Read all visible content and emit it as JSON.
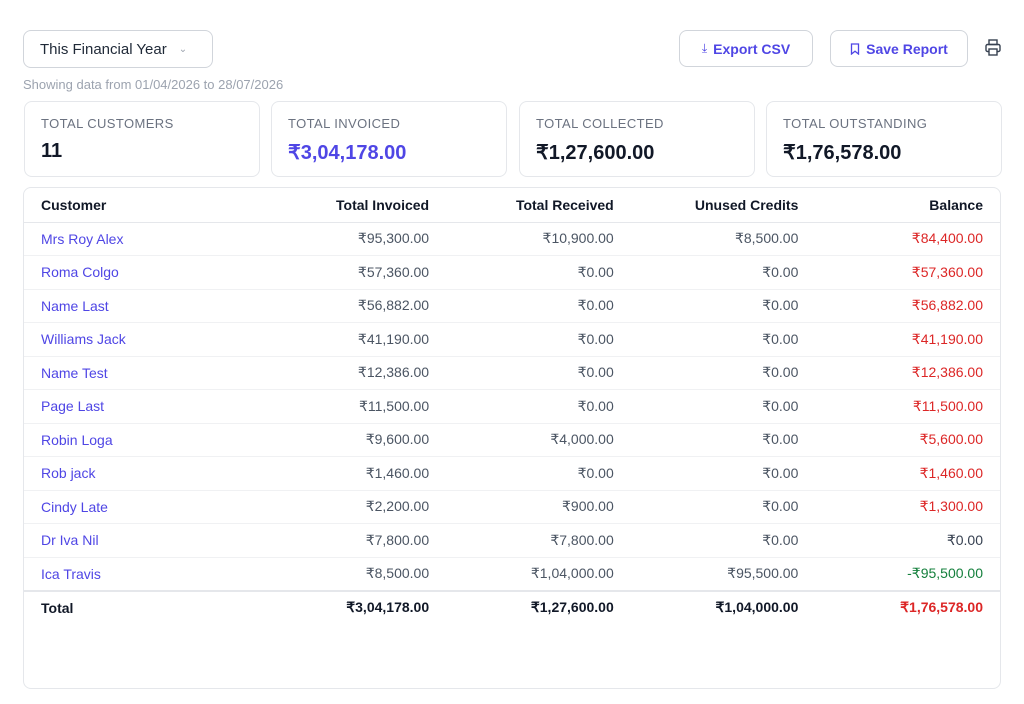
{
  "filter": {
    "period": "This Financial Year"
  },
  "actions": {
    "export_label": "Export CSV",
    "save_label": "Save Report"
  },
  "range_note": "Showing data from 01/04/2026 to 28/07/2026",
  "cards": [
    {
      "title": "TOTAL CUSTOMERS",
      "value": "11"
    },
    {
      "title": "TOTAL INVOICED",
      "value": "₹3,04,178.00"
    },
    {
      "title": "TOTAL COLLECTED",
      "value": "₹1,27,600.00"
    },
    {
      "title": "TOTAL OUTSTANDING",
      "value": "₹1,76,578.00"
    }
  ],
  "table": {
    "headers": [
      "Customer",
      "Total Invoiced",
      "Total Received",
      "Unused Credits",
      "Balance"
    ],
    "rows": [
      {
        "customer": "Mrs Roy Alex",
        "invoiced": "₹95,300.00",
        "received": "₹10,900.00",
        "credits": "₹8,500.00",
        "balance": "₹84,400.00",
        "status": "pos"
      },
      {
        "customer": "Roma Colgo",
        "invoiced": "₹57,360.00",
        "received": "₹0.00",
        "credits": "₹0.00",
        "balance": "₹57,360.00",
        "status": "pos"
      },
      {
        "customer": "Name Last",
        "invoiced": "₹56,882.00",
        "received": "₹0.00",
        "credits": "₹0.00",
        "balance": "₹56,882.00",
        "status": "pos"
      },
      {
        "customer": "Williams Jack",
        "invoiced": "₹41,190.00",
        "received": "₹0.00",
        "credits": "₹0.00",
        "balance": "₹41,190.00",
        "status": "pos"
      },
      {
        "customer": "Name Test",
        "invoiced": "₹12,386.00",
        "received": "₹0.00",
        "credits": "₹0.00",
        "balance": "₹12,386.00",
        "status": "pos"
      },
      {
        "customer": "Page Last",
        "invoiced": "₹11,500.00",
        "received": "₹0.00",
        "credits": "₹0.00",
        "balance": "₹11,500.00",
        "status": "pos"
      },
      {
        "customer": "Robin Loga",
        "invoiced": "₹9,600.00",
        "received": "₹4,000.00",
        "credits": "₹0.00",
        "balance": "₹5,600.00",
        "status": "pos"
      },
      {
        "customer": "Rob jack",
        "invoiced": "₹1,460.00",
        "received": "₹0.00",
        "credits": "₹0.00",
        "balance": "₹1,460.00",
        "status": "pos"
      },
      {
        "customer": "Cindy Late",
        "invoiced": "₹2,200.00",
        "received": "₹900.00",
        "credits": "₹0.00",
        "balance": "₹1,300.00",
        "status": "pos"
      },
      {
        "customer": "Dr Iva Nil",
        "invoiced": "₹7,800.00",
        "received": "₹7,800.00",
        "credits": "₹0.00",
        "balance": "₹0.00",
        "status": "zero"
      },
      {
        "customer": "Ica Travis",
        "invoiced": "₹8,500.00",
        "received": "₹1,04,000.00",
        "credits": "₹95,500.00",
        "balance": "-₹95,500.00",
        "status": "neg"
      }
    ],
    "total": {
      "label": "Total",
      "invoiced": "₹3,04,178.00",
      "received": "₹1,27,600.00",
      "credits": "₹1,04,000.00",
      "balance": "₹1,76,578.00"
    }
  },
  "colors": {
    "accent": "#4f46e5",
    "positive_balance": "#dc2626",
    "negative_balance": "#15803d"
  },
  "icons": {
    "export": "download-icon",
    "save": "bookmark-icon",
    "print": "printer-icon",
    "dropdown": "chevron-down-icon"
  }
}
